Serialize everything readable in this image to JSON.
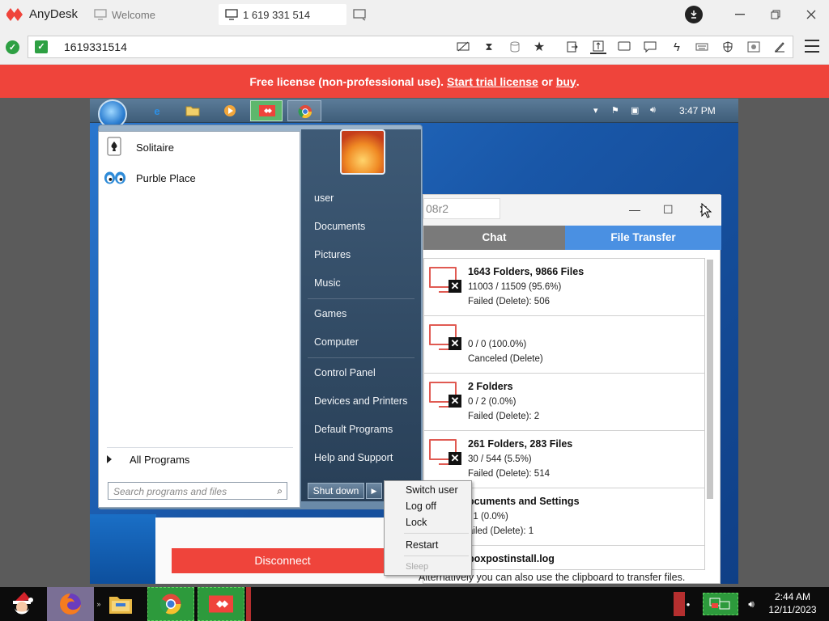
{
  "app": {
    "name": "AnyDesk"
  },
  "tabs": [
    {
      "label": "Welcome",
      "icon": "monitor-outline-icon"
    },
    {
      "label": "1 619 331 514",
      "icon": "monitor-icon"
    }
  ],
  "address": {
    "value": "1619331514"
  },
  "banner": {
    "prefix": "Free license (non-professional use).",
    "trial_link": "Start trial license",
    "or": "or",
    "buy_link": "buy",
    "suffix": "."
  },
  "remote": {
    "taskbar": {
      "clock": "3:47 PM"
    },
    "start_menu": {
      "programs": [
        {
          "label": "Solitaire",
          "icon": "solitaire-icon"
        },
        {
          "label": "Purble Place",
          "icon": "purble-place-icon"
        }
      ],
      "all_programs": "All Programs",
      "search_placeholder": "Search programs and files",
      "right_links": [
        "user",
        "Documents",
        "Pictures",
        "Music",
        "Games",
        "Computer",
        "Control Panel",
        "Devices and Printers",
        "Default Programs",
        "Help and Support"
      ],
      "shutdown": "Shut down"
    },
    "power_menu": {
      "items": [
        "Switch user",
        "Log off",
        "Lock",
        "Restart",
        "Sleep"
      ]
    },
    "file_transfer": {
      "title_field": "08r2",
      "tabs": {
        "chat": "Chat",
        "file_transfer": "File Transfer"
      },
      "items": [
        {
          "title": "1643 Folders, 9866 Files",
          "progress": "11003 / 11509 (95.6%)",
          "status": "Failed (Delete): 506"
        },
        {
          "title": "",
          "progress": "0 / 0 (100.0%)",
          "status": "Canceled (Delete)"
        },
        {
          "title": "2 Folders",
          "progress": "0 / 2 (0.0%)",
          "status": "Failed (Delete): 2"
        },
        {
          "title": "261 Folders, 283 Files",
          "progress": "30 / 544 (5.5%)",
          "status": "Failed (Delete): 514"
        },
        {
          "title": "ocuments and Settings",
          "progress": "/ 1 (0.0%)",
          "status": "ailed (Delete): 1"
        },
        {
          "title": "boxpostinstall.log",
          "progress": "",
          "status": ""
        }
      ],
      "hint": "Alternatively you can also use the clipboard to transfer files."
    },
    "disconnect": "Disconnect"
  },
  "local_taskbar": {
    "time": "2:44 AM",
    "date": "12/11/2023"
  },
  "colors": {
    "brand_red": "#ef443b",
    "file_transfer_tab": "#4a90e2",
    "chat_tab": "#7a7a7a"
  }
}
